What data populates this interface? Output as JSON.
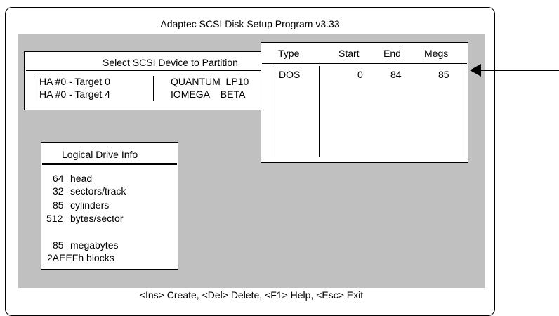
{
  "window": {
    "title": "Adaptec SCSI Disk Setup Program v3.33"
  },
  "device_dialog": {
    "title": "Select SCSI Device to Partition",
    "devices": [
      {
        "target": "HA #0 - Target 0",
        "vendor": "QUANTUM  LP10"
      },
      {
        "target": "HA #0 - Target 4",
        "vendor": "IOMEGA    BETA"
      }
    ]
  },
  "partition_table": {
    "headers": [
      "Type",
      "Start",
      "End",
      "Megs"
    ],
    "rows": [
      {
        "type": "DOS",
        "start": "0",
        "end": "84",
        "megs": "85"
      }
    ]
  },
  "logical_drive": {
    "title": "Logical Drive Info",
    "lines": [
      {
        "num": "64",
        "label": "head"
      },
      {
        "num": "32",
        "label": "sectors/track"
      },
      {
        "num": "85",
        "label": "cylinders"
      },
      {
        "num": "512",
        "label": "bytes/sector"
      },
      {
        "num": "85",
        "label": "megabytes"
      }
    ],
    "blocks": "2AEEFh blocks"
  },
  "footer": {
    "help": "<Ins> Create,  <Del>  Delete,  <F1> Help,  <Esc> Exit"
  }
}
